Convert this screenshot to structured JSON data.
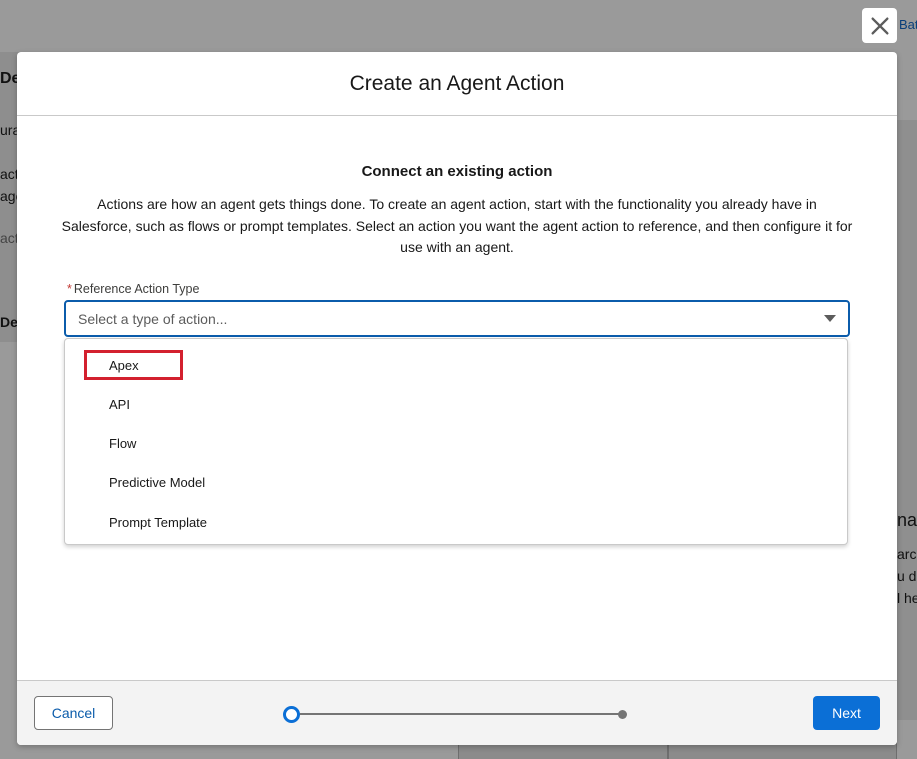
{
  "modal": {
    "title": "Create an Agent Action",
    "heading": "Connect an existing action",
    "description": "Actions are how an agent gets things done. To create an agent action, start with the functionality you already have in Salesforce, such as flows or prompt templates. Select an action you want the agent action to reference, and then configure it for use with an agent."
  },
  "field": {
    "required_marker": "*",
    "label": "Reference Action Type",
    "placeholder": "Select a type of action..."
  },
  "dropdown": {
    "options": [
      "Apex",
      "API",
      "Flow",
      "Predictive Model",
      "Prompt Template"
    ],
    "highlighted": "Apex"
  },
  "footer": {
    "cancel_label": "Cancel",
    "next_label": "Next",
    "progress_step": 1,
    "progress_total": 2
  },
  "background": {
    "top_link": "Bat",
    "left_fragments": [
      "Det",
      "urat",
      "acti",
      "age",
      "act",
      "Des"
    ],
    "right_fragments": [
      "nat",
      "arch",
      "u d",
      "l he"
    ]
  },
  "colors": {
    "brand": "#0b6fd6",
    "highlight": "#d3202e",
    "required": "#c23934"
  }
}
